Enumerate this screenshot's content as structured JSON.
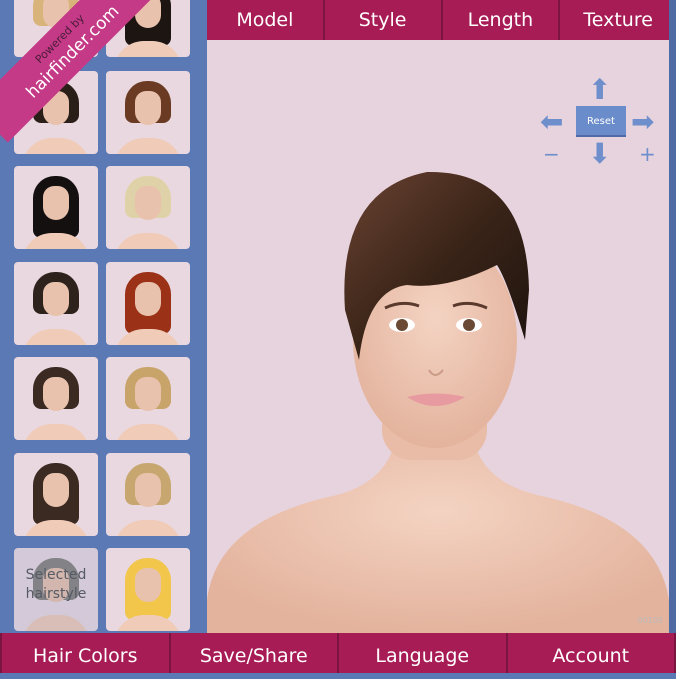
{
  "branding": {
    "powered_by": "Powered by",
    "site": "hairfinder.com"
  },
  "top_nav": [
    {
      "label": "Model"
    },
    {
      "label": "Style"
    },
    {
      "label": "Length"
    },
    {
      "label": "Texture"
    }
  ],
  "bottom_nav": [
    {
      "label": "Hair Colors"
    },
    {
      "label": "Save/Share"
    },
    {
      "label": "Language"
    },
    {
      "label": "Account"
    }
  ],
  "sidebar": {
    "selected_label_1": "Selected",
    "selected_label_2": "hairstyle",
    "thumbnails": [
      {
        "hair": "#d9b47a"
      },
      {
        "hair": "#1d1512"
      },
      {
        "hair": "#2a1e18"
      },
      {
        "hair": "#6b3a22"
      },
      {
        "hair": "#141010"
      },
      {
        "hair": "#e0d2a8"
      },
      {
        "hair": "#2e231c"
      },
      {
        "hair": "#9b3218"
      },
      {
        "hair": "#3a2a22"
      },
      {
        "hair": "#c8a46a"
      },
      {
        "hair": "#3b2a22"
      },
      {
        "hair": "#c7a66f"
      },
      {
        "hair": "#8a8580"
      },
      {
        "hair": "#f1c64a"
      }
    ]
  },
  "controls": {
    "reset_label": "Reset",
    "zoom_out": "−",
    "zoom_in": "+",
    "icons": [
      "arrow-up-icon",
      "arrow-down-icon",
      "arrow-left-icon",
      "arrow-right-icon"
    ]
  },
  "image_code": "00105",
  "colors": {
    "nav": "#a81c56",
    "sidebar": "#5b79b4",
    "canvas": "#e7d3de",
    "ribbon": "#c43a86"
  }
}
